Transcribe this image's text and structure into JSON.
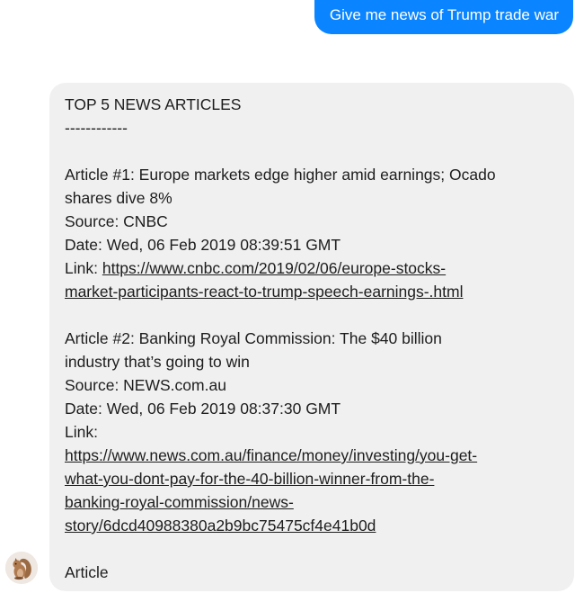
{
  "user_message": "Give me news of Trump trade war",
  "bot_message": {
    "heading": "TOP 5 NEWS ARTICLES",
    "divider": "------------",
    "articles": [
      {
        "title_lines": [
          "Article #1: Europe markets edge higher amid earnings; Ocado",
          "shares dive 8%"
        ],
        "source": "Source: CNBC",
        "date": "Date: Wed, 06 Feb 2019 08:39:51 GMT",
        "link_label": "Link:",
        "link_lines": [
          "https://www.cnbc.com/2019/02/06/europe-stocks-",
          "market-participants-react-to-trump-speech-earnings-.html"
        ]
      },
      {
        "title_lines": [
          "Article #2: Banking Royal Commission: The $40 billion",
          "industry that’s going to win"
        ],
        "source": "Source: NEWS.com.au",
        "date": "Date: Wed, 06 Feb 2019 08:37:30 GMT",
        "link_label": "Link:",
        "link_lines": [
          "https://www.news.com.au/finance/money/investing/you-get-",
          "what-you-dont-pay-for-the-40-billion-winner-from-the-",
          "banking-royal-commission/news-",
          "story/6dcd40988380a2b9bc75475cf4e41b0d"
        ]
      }
    ],
    "trailing_text": "Article"
  },
  "avatar": {
    "icon": "squirrel-avatar-icon"
  },
  "colors": {
    "user_bubble": "#0a84ff",
    "bot_bubble": "#f1f0f0",
    "text": "#1d1d1d"
  }
}
